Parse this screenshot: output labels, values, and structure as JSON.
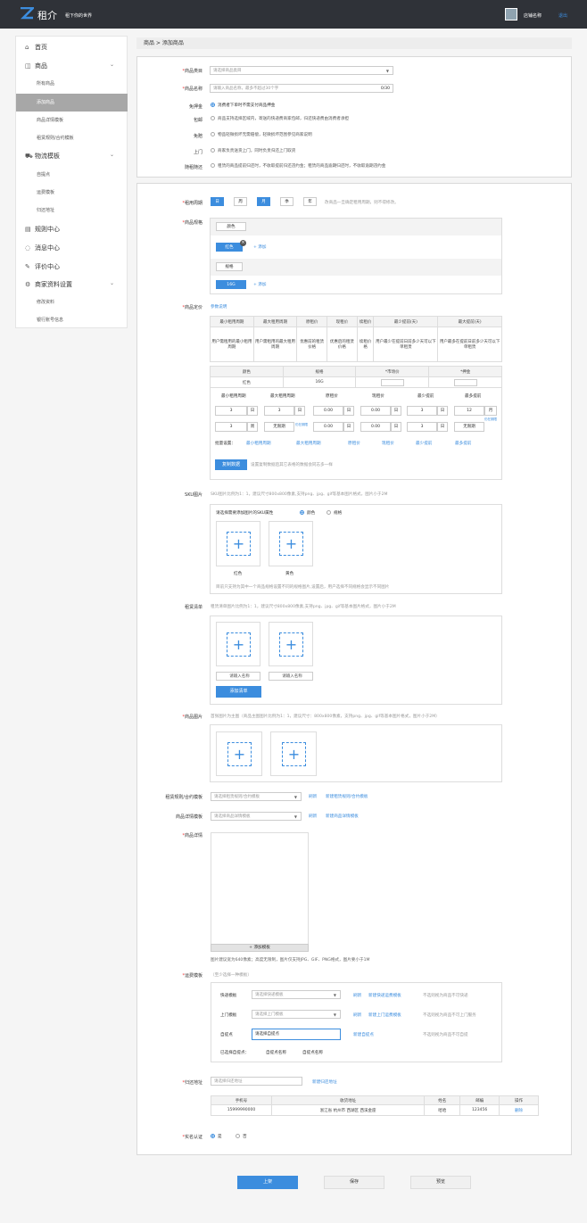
{
  "header": {
    "logo_text": "租介",
    "slogan": "租下你的世界",
    "shop_name": "店铺名称",
    "logout": "退出"
  },
  "sidebar": {
    "home": "首页",
    "goods": "商品",
    "goods_items": [
      "所有商品",
      "添加商品",
      "商品详情模板",
      "租赁规则/合约模板"
    ],
    "logistics": "物流模板",
    "logistics_items": [
      "自提点",
      "运费模板",
      "归还地址"
    ],
    "rules": "规则中心",
    "messages": "消息中心",
    "reviews": "评价中心",
    "merchant": "商家资料设置",
    "merchant_items": [
      "修改资料",
      "银行账号信息"
    ]
  },
  "breadcrumb": "商品 > 添加商品",
  "basic": {
    "category_label": "商品类目",
    "category_placeholder": "请选择商品类目",
    "name_label": "商品名称",
    "name_placeholder": "请输入商品名称，最多不超过30个字",
    "name_count": "0/30",
    "deposit_label": "免押金",
    "deposit_text": "消费者下单时不需支付商品押金",
    "shipping_label": "包邮",
    "shipping_text": "商品支持选择区域内，寄送的快递费商家包邮，归还快递费由消费者承担",
    "free_damage_label": "免赔",
    "free_damage_text": "物品轻微损坏无需赔偿，轻微损坏范围参见商家说明",
    "door_label": "上门",
    "door_text": "商家负责送货上门，同时负责归还上门取货",
    "return_label": "随租随还",
    "return_text": "租赁的商品提前归还时，不收取提前归还违约金；租赁的商品逾期归还时，不收取逾期违约金"
  },
  "spec": {
    "period_label": "租用周期",
    "periods": [
      "日",
      "周",
      "月",
      "季",
      "年"
    ],
    "period_hint": "改商品一旦确定租用周期，则不得修改。",
    "spec_label": "商品规格",
    "color_group": "颜色",
    "color_value": "红色",
    "add": "+ 添加",
    "size_group": "规格",
    "size_value": "16G",
    "price_label": "商品定价",
    "param_link": "参数说明",
    "param_headers": [
      "最小租用周期",
      "最大租用周期",
      "原租价",
      "现租价",
      "续租价",
      "最少提前(天)",
      "最大提前(天)"
    ],
    "param_desc": [
      "用户需租用的最小租用周期",
      "用户需租用的最大租用周期",
      "优惠前的租赁价格",
      "优惠后的租赁价格",
      "续租价格",
      "用户最少在提前日前多少天可以下单租赁",
      "用户最多在提前日前多少天可以下单租赁"
    ],
    "sku_headers": [
      "颜色",
      "规格",
      "*市场价",
      "*押金"
    ],
    "sku_row": [
      "红色",
      "16G"
    ],
    "price_headers": [
      "最小租用周期",
      "最大租用周期",
      "原租价",
      "现租价",
      "最少提前",
      "最多提前"
    ],
    "row1": {
      "min": "3",
      "min_unit": "日",
      "max": "3",
      "max_unit": "日",
      "orig": "0.00",
      "orig_unit": "日",
      "cur": "0.00",
      "cur_unit": "日",
      "least": "3",
      "least_unit": "日",
      "most": "12",
      "most_unit": "月"
    },
    "row1_note": "仍在期限",
    "row2": {
      "min": "3",
      "min_unit": "周",
      "max": "无限期",
      "orig": "0.00",
      "orig_unit": "日",
      "cur": "0.00",
      "cur_unit": "日",
      "least": "3",
      "least_unit": "日",
      "most": "无限期"
    },
    "row2_note": "仍在期限",
    "batch_label": "批量设置：",
    "batch_items": [
      "最小租用周期",
      "最大租用周期",
      "原租价",
      "现租价",
      "最少提前",
      "最多提前"
    ],
    "copy_button": "复制数据",
    "copy_hint": "设置复制数据后其它表格的数据会同志多一样"
  },
  "sku_img": {
    "label": "SKU图片",
    "hint": "SKU图片比例为1：1，建议尺寸800x800像素,支持png、jpg、gif等基本图片格式，图片小于2M",
    "choose": "请选择需要添加图片的SKU属性",
    "opt_color": "颜色",
    "opt_size": "规格",
    "items": [
      "红色",
      "黄色"
    ],
    "note": "目前只支持为其中一个商品规格设置不同的规格图片,设置后，用户选择不同规格会显示不同图片"
  },
  "rent_list": {
    "label": "租赁清单",
    "hint": "租赁清单图片比例为1：1，建议尺寸800x800像素,支持png、jpg、gif等基本图片格式，图片小于2M",
    "name_placeholder": "请输入名称",
    "add_button": "添加清单"
  },
  "goods_img": {
    "label": "商品图片",
    "hint": "首张图片为主图（商品主图图片比例为1：1，建议尺寸：800x800像素，支持png、jpg、gif等基本图片格式，图片小于2M）"
  },
  "templates": {
    "rule_label": "租赁规则/合约模板",
    "rule_placeholder": "请选择租赁规则/合约模板",
    "refresh": "刷新",
    "rule_new": "新建租赁规则/合约模板",
    "detail_label": "商品详情模板",
    "detail_placeholder": "请选择商品详情模板",
    "detail_new": "新建商品详情模板"
  },
  "detail": {
    "label": "商品详情",
    "add_template": "+ 添加模板",
    "hint": "图片建议宽为640像素；高度无限制，图片仅支持JPG、GIF、PNG格式，图片要小于1M"
  },
  "freight": {
    "label": "运费模板",
    "note": "（至少选择一种模板）",
    "express_label": "快递模板",
    "express_placeholder": "请选择快递模板",
    "refresh": "刷新",
    "express_new": "新建快递运费模板",
    "express_hint": "不选则视为商品不可快递",
    "door_label": "上门模板",
    "door_placeholder": "请选择上门模板",
    "door_new": "新建上门运费模板",
    "door_hint": "不选则视为商品不可上门服务",
    "pickup_label": "自提点",
    "pickup_placeholder": "请选择自提点",
    "pickup_new": "新建自提点",
    "pickup_hint": "不选则视为商品不可自提",
    "selected_label": "已选择自提点：",
    "selected": [
      "自提点名称",
      "自提点名称"
    ]
  },
  "return_addr": {
    "label": "归还地址",
    "placeholder": "请选择归还地址",
    "new": "新建归还地址",
    "headers": [
      "手机号",
      "收货地址",
      "姓名",
      "邮编",
      "操作"
    ],
    "row": [
      "15999990000",
      "浙江省 杭州市 西湖区 西溪金座",
      "哈哈",
      "123456",
      "删除"
    ]
  },
  "realname": {
    "label": "实名认证",
    "yes": "是",
    "no": "否"
  },
  "actions": {
    "submit": "上架",
    "save": "保存",
    "preview": "预览"
  }
}
